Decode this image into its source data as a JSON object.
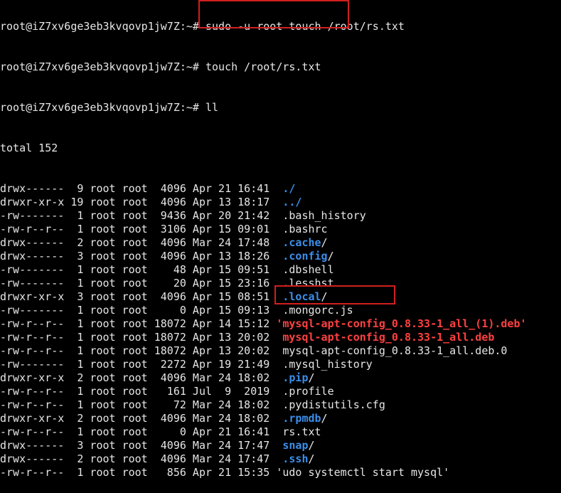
{
  "terminal": {
    "top_partial": "root@iZ7xv6ge3eb3kvqovp1jw7Z:~# sudo -u root touch /root/rs.txt",
    "prompt1": "root@iZ7xv6ge3eb3kvqovp1jw7Z:~# ",
    "cmd1": "touch /root/rs.txt",
    "prompt2": "root@iZ7xv6ge3eb3kvqovp1jw7Z:~# ",
    "cmd2": "ll",
    "total": "total 152",
    "entries": [
      {
        "meta": "drwx------  9 root root  4096 Apr 21 16:41  ",
        "name": "./",
        "kind": "dir"
      },
      {
        "meta": "drwxr-xr-x 19 root root  4096 Apr 13 18:17  ",
        "name": "../",
        "kind": "dir"
      },
      {
        "meta": "-rw-------  1 root root  9436 Apr 20 21:42  ",
        "name": ".bash_history",
        "kind": "file"
      },
      {
        "meta": "-rw-r--r--  1 root root  3106 Apr 15 09:01  ",
        "name": ".bashrc",
        "kind": "file"
      },
      {
        "meta": "drwx------  2 root root  4096 Mar 24 17:48  ",
        "name": ".cache",
        "kind": "dir",
        "suffix": "/"
      },
      {
        "meta": "drwx------  3 root root  4096 Apr 13 18:26  ",
        "name": ".config",
        "kind": "dir",
        "suffix": "/"
      },
      {
        "meta": "-rw-------  1 root root    48 Apr 15 09:51  ",
        "name": ".dbshell",
        "kind": "file"
      },
      {
        "meta": "-rw-------  1 root root    20 Apr 15 23:16  ",
        "name": ".lesshst",
        "kind": "file"
      },
      {
        "meta": "drwxr-xr-x  3 root root  4096 Apr 15 08:51  ",
        "name": ".local",
        "kind": "dir",
        "suffix": "/"
      },
      {
        "meta": "-rw-------  1 root root     0 Apr 15 09:13  ",
        "name": ".mongorc.js",
        "kind": "file"
      },
      {
        "meta": "-rw-r--r--  1 root root 18072 Apr 14 15:12 ",
        "name": "'mysql-apt-config_0.8.33-1_all_(1).deb'",
        "kind": "deb"
      },
      {
        "meta": "-rw-r--r--  1 root root 18072 Apr 13 20:02  ",
        "name": "mysql-apt-config_0.8.33-1_all.deb",
        "kind": "deb"
      },
      {
        "meta": "-rw-r--r--  1 root root 18072 Apr 13 20:02  ",
        "name": "mysql-apt-config_0.8.33-1_all.deb.0",
        "kind": "file"
      },
      {
        "meta": "-rw-------  1 root root  2272 Apr 19 21:49  ",
        "name": ".mysql_history",
        "kind": "file"
      },
      {
        "meta": "drwxr-xr-x  2 root root  4096 Mar 24 18:02  ",
        "name": ".pip",
        "kind": "dir",
        "suffix": "/"
      },
      {
        "meta": "-rw-r--r--  1 root root   161 Jul  9  2019  ",
        "name": ".profile",
        "kind": "file"
      },
      {
        "meta": "-rw-r--r--  1 root root    72 Mar 24 18:02  ",
        "name": ".pydistutils.cfg",
        "kind": "file"
      },
      {
        "meta": "drwxr-xr-x  2 root root  4096 Mar 24 18:02  ",
        "name": ".rpmdb",
        "kind": "dir",
        "suffix": "/"
      },
      {
        "meta": "-rw-r--r--  1 root root     0 Apr 21 16:41  ",
        "name": "rs.txt",
        "kind": "file"
      },
      {
        "meta": "drwx------  3 root root  4096 Mar 24 17:47  ",
        "name": "snap",
        "kind": "dir",
        "suffix": "/"
      },
      {
        "meta": "drwx------  2 root root  4096 Mar 24 17:47  ",
        "name": ".ssh",
        "kind": "dir",
        "suffix": "/"
      },
      {
        "meta": "-rw-r--r--  1 root root   856 Apr 21 15:35 ",
        "name": "'udo systemctl start mysql'",
        "kind": "file"
      }
    ]
  },
  "colors": {
    "background": "#000000",
    "text": "#e6e6e6",
    "directory": "#3b8eea",
    "deb_package": "#ff4040",
    "highlight_box": "#d21f1f"
  }
}
